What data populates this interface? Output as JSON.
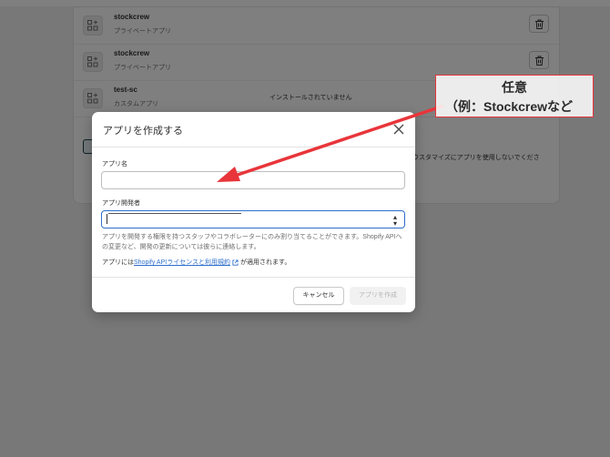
{
  "background_page": {
    "apps": [
      {
        "name": "stockcrew",
        "type": "プライベートアプリ",
        "status": "",
        "has_delete": true
      },
      {
        "name": "stockcrew",
        "type": "プライベートアプリ",
        "status": "",
        "has_delete": true
      },
      {
        "name": "test-sc",
        "type": "カスタムアプリ",
        "status": "インストールされていません",
        "has_delete": false
      }
    ],
    "banner_text": "ウスタマイズにアプリを使用しないでくださ"
  },
  "modal": {
    "title": "アプリを作成する",
    "app_name_label": "アプリ名",
    "app_name_value": "",
    "developer_label": "アプリ開発者",
    "developer_value": "",
    "help_text": "アプリを開発する権限を持つスタッフやコラボレーターにのみ割り当てることができます。Shopify APIへの変更など、開発の更新については彼らに連絡します。",
    "license_prefix": "アプリには",
    "license_link": "Shopify APIライセンスと利用規約",
    "license_suffix": "が適用されます。",
    "cancel_label": "キャンセル",
    "create_label": "アプリを作成"
  },
  "annotation": {
    "line1": "任意",
    "line2": "（例：Stockcrewなど"
  },
  "colors": {
    "annotation_red": "#e8353a",
    "link_blue": "#2c6ecb",
    "focus_border": "#2c6ecb",
    "overlay": "rgba(0,0,0,0.5)"
  },
  "icons": [
    "app-icon",
    "trash-icon",
    "close-icon",
    "external-link-icon",
    "select-caret-icon",
    "arrow-icon"
  ]
}
